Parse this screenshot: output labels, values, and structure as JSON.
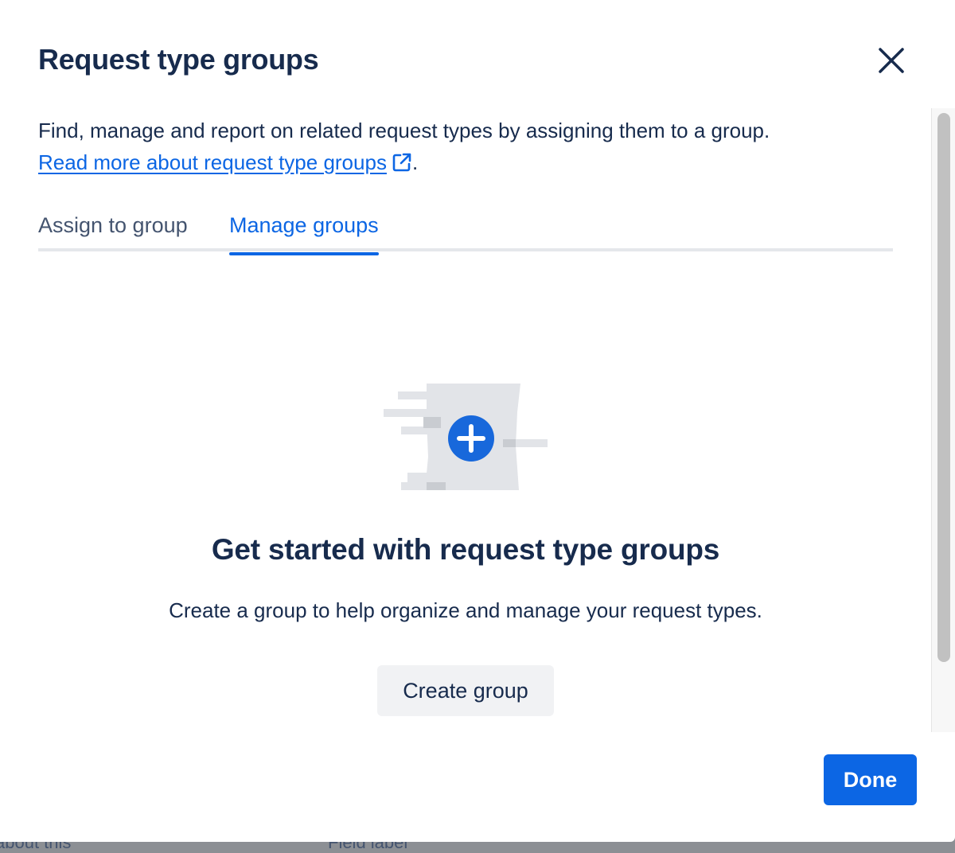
{
  "modal": {
    "title": "Request type groups",
    "close_icon": "close-icon"
  },
  "description": {
    "text": "Find, manage and report on related request types by assigning them to a group.",
    "link_text": "Read more about request type groups",
    "link_suffix": ".",
    "link_icon": "external-link-icon"
  },
  "tabs": [
    {
      "label": "Assign to group",
      "selected": false
    },
    {
      "label": "Manage groups",
      "selected": true
    }
  ],
  "empty_state": {
    "illustration_icon": "add-circle-icon",
    "heading": "Get started with request type groups",
    "description": "Create a group to help organize and manage your request types.",
    "create_button_label": "Create group"
  },
  "footer": {
    "done_button_label": "Done"
  },
  "background": {
    "text_left": "about this",
    "text_right": "Field label"
  },
  "colors": {
    "accent": "#0c66e4",
    "text": "#172b4d",
    "subtle_text": "#44546f",
    "neutral_button": "#f1f2f4"
  }
}
